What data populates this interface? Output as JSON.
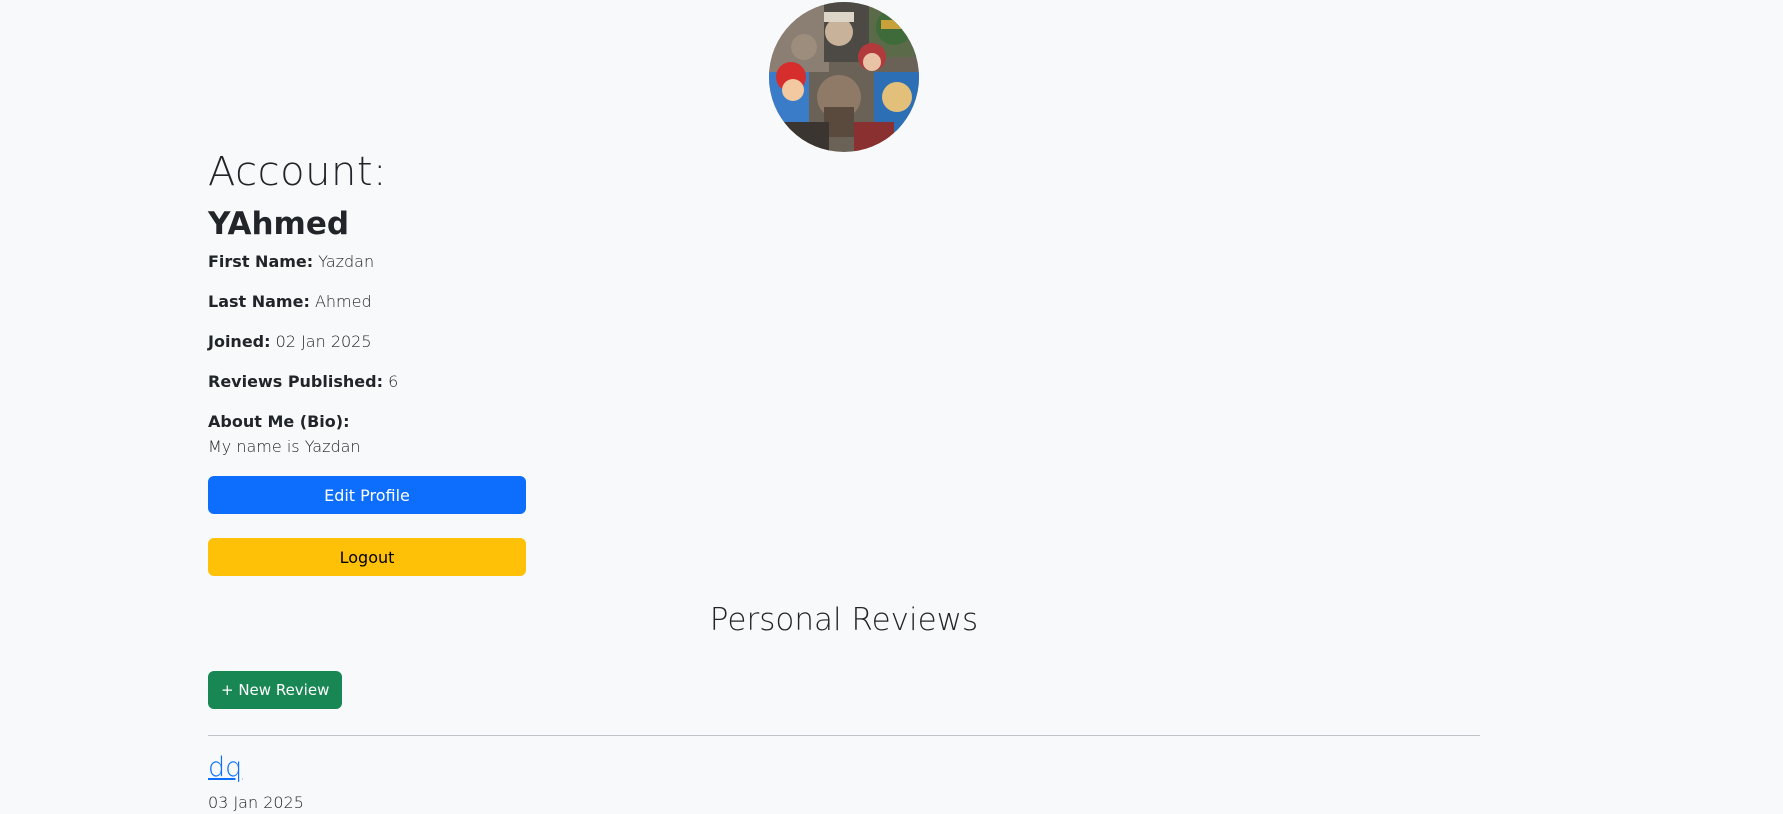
{
  "profile": {
    "account_label": "Account:",
    "username": "YAhmed",
    "fields": [
      {
        "label": "First Name:",
        "value": "Yazdan"
      },
      {
        "label": "Last Name:",
        "value": "Ahmed"
      },
      {
        "label": "Joined:",
        "value": "02 Jan 2025"
      },
      {
        "label": "Reviews Published:",
        "value": "6"
      }
    ],
    "bio_label": "About Me (Bio):",
    "bio_value": "My name is Yazdan"
  },
  "actions": {
    "edit_label": "Edit Profile",
    "logout_label": "Logout"
  },
  "reviews": {
    "section_title": "Personal Reviews",
    "new_review_label": "+ New Review",
    "items": [
      {
        "title": "dq",
        "date": "03 Jan 2025"
      }
    ]
  },
  "colors": {
    "primary": "#0d6efd",
    "warning": "#ffc107",
    "success": "#198754",
    "background": "#f8f9fa"
  }
}
